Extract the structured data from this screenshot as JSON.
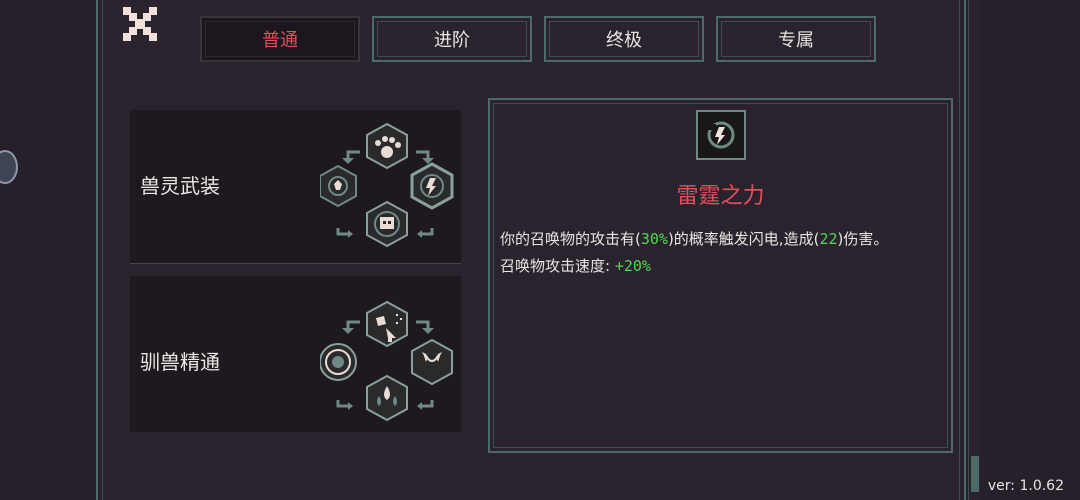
{
  "tabs": [
    {
      "label": "普通",
      "active": true
    },
    {
      "label": "进阶",
      "active": false
    },
    {
      "label": "终极",
      "active": false
    },
    {
      "label": "专属",
      "active": false
    }
  ],
  "skills": [
    {
      "name": "兽灵武装"
    },
    {
      "name": "驯兽精通"
    }
  ],
  "detail": {
    "title": "雷霆之力",
    "line1_a": "你的召唤物的攻击有(",
    "line1_chance": "30%",
    "line1_b": ")的概率触发闪电,造成(",
    "line1_damage": "22",
    "line1_c": ")伤害。",
    "line2_label": "召唤物攻击速度:",
    "line2_value": "+20%"
  },
  "version": "ver: 1.0.62",
  "colors": {
    "active_tab": "#e0505a",
    "highlight": "#4ddb4d",
    "frame": "#4d6b66"
  },
  "icons": [
    "close-icon",
    "claw-icon",
    "paw-icon",
    "skull-icon",
    "lightning-icon",
    "beast-head-icon",
    "fang-icon",
    "drops-icon",
    "target-icon"
  ]
}
